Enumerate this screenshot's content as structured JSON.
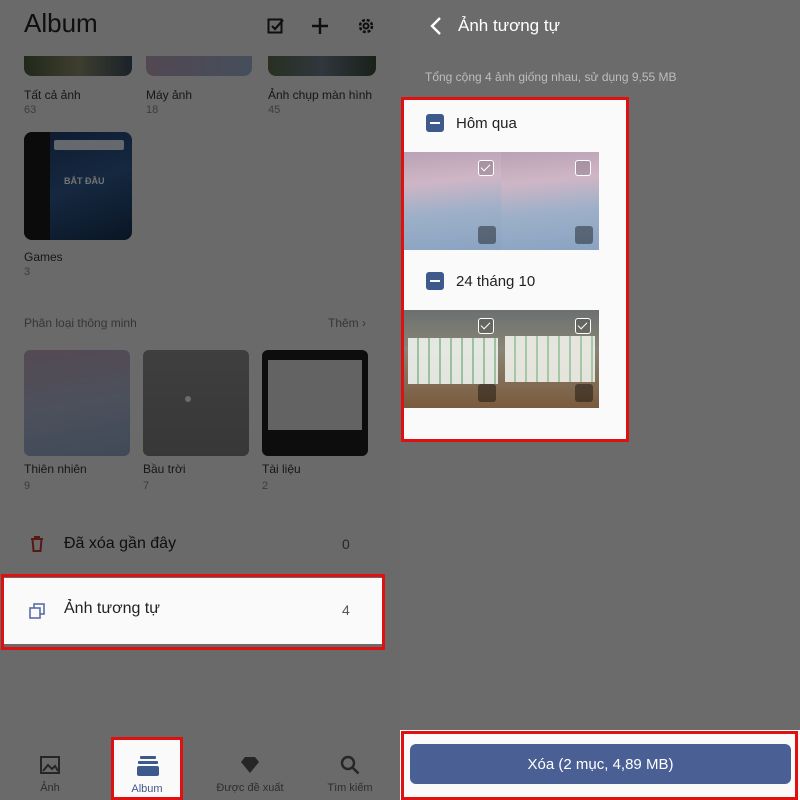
{
  "left": {
    "title": "Album",
    "top_albums": [
      {
        "name": "Tất cả ảnh",
        "count": "63"
      },
      {
        "name": "Máy ảnh",
        "count": "18"
      },
      {
        "name": "Ảnh chụp màn hình",
        "count": "45"
      }
    ],
    "games": {
      "name": "Games",
      "count": "3",
      "thumb_text": "BẮT ĐẦU"
    },
    "smart": {
      "label": "Phân loại thông minh",
      "more": "Thêm",
      "items": [
        {
          "name": "Thiên nhiên",
          "count": "9"
        },
        {
          "name": "Bầu trời",
          "count": "7"
        },
        {
          "name": "Tài liệu",
          "count": "2"
        }
      ]
    },
    "recently_deleted": {
      "label": "Đã xóa gần đây",
      "count": "0"
    },
    "similar": {
      "label": "Ảnh tương tự",
      "count": "4"
    },
    "nav": [
      {
        "label": "Ảnh",
        "icon": "image-icon"
      },
      {
        "label": "Album",
        "icon": "album-icon"
      },
      {
        "label": "Được đề xuất",
        "icon": "diamond-icon"
      },
      {
        "label": "Tìm kiếm",
        "icon": "search-icon"
      }
    ]
  },
  "right": {
    "title": "Ảnh tương tự",
    "summary": "Tổng cộng 4 ảnh giống nhau, sử dụng 9,55 MB",
    "groups": [
      {
        "label": "Hôm qua",
        "photos": [
          {
            "checked": true
          },
          {
            "checked": false
          }
        ]
      },
      {
        "label": "24 tháng 10",
        "photos": [
          {
            "checked": true
          },
          {
            "checked": true
          }
        ]
      }
    ],
    "delete_label": "Xóa (2 mục, 4,89 MB)"
  },
  "colors": {
    "highlight": "#e01010",
    "accent": "#4a5f94",
    "trash": "#c0392b"
  }
}
